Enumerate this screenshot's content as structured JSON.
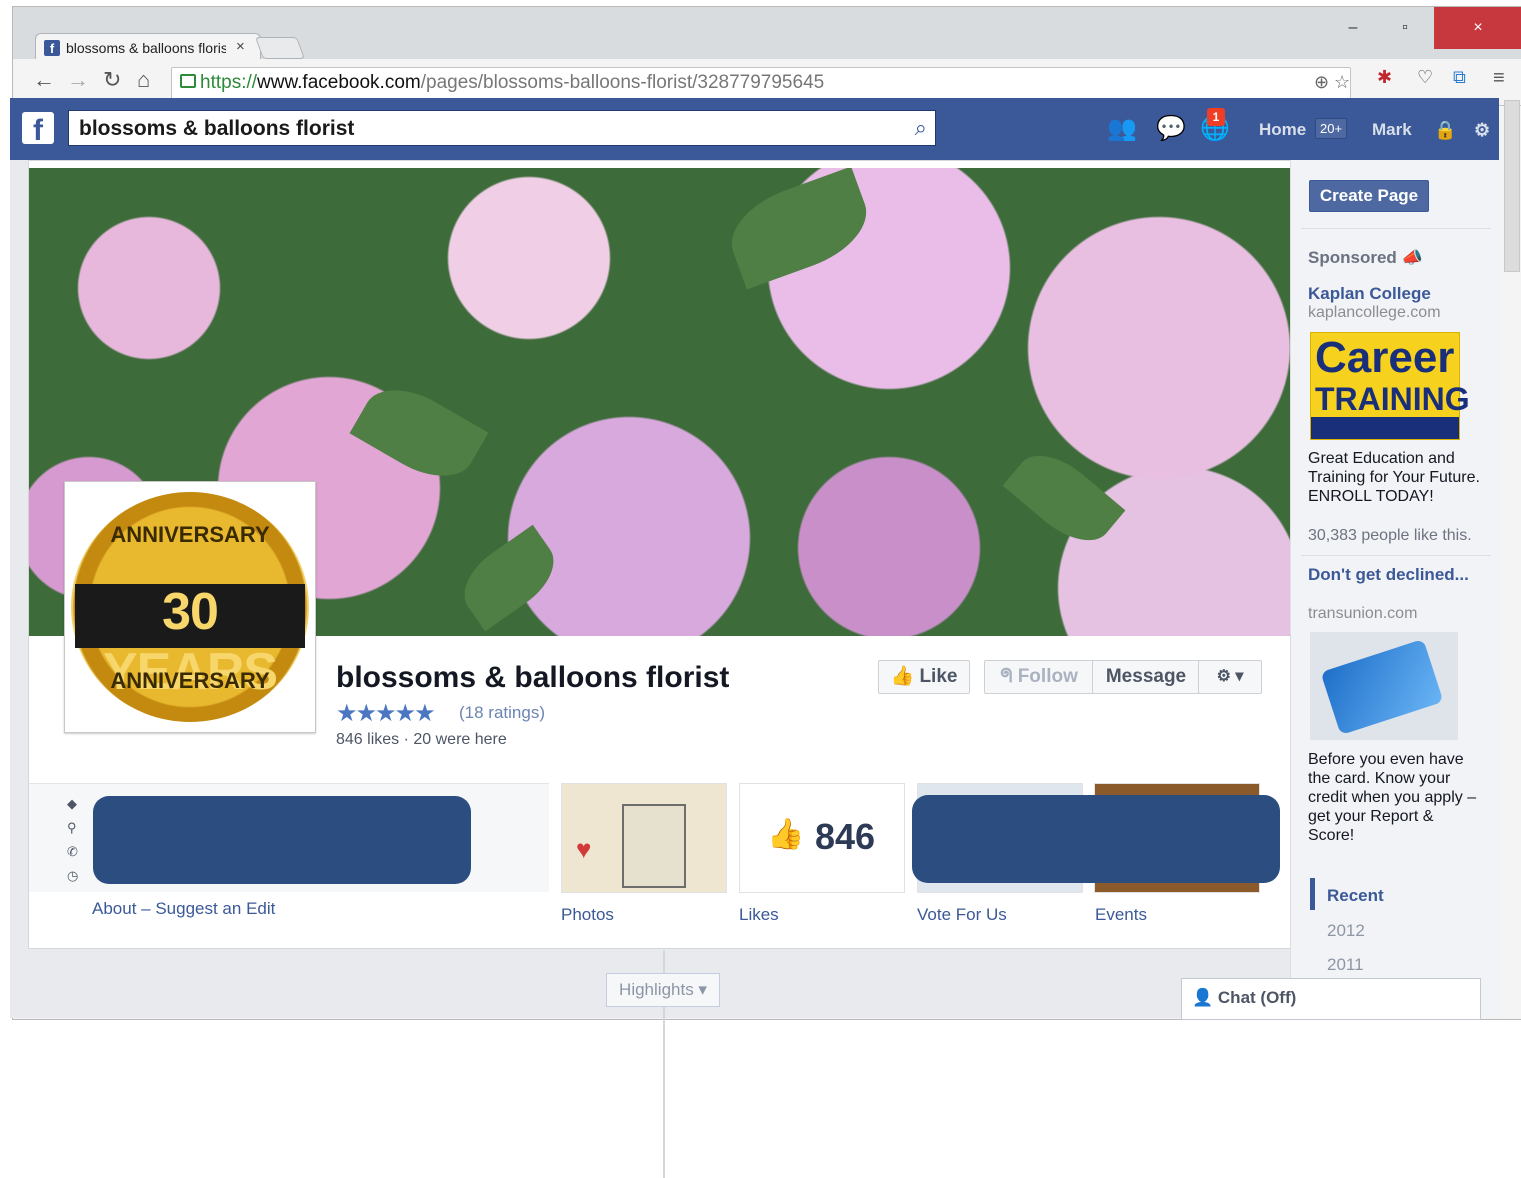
{
  "browser": {
    "tab_title": "blossoms & balloons floris",
    "tab_close": "×",
    "url_scheme": "https://",
    "url_host": "www.facebook.com",
    "url_path": "/pages/blossoms-balloons-florist/328779795645",
    "window_buttons": [
      "–",
      "▫",
      "×"
    ]
  },
  "fb": {
    "logo": "f",
    "search_value": "blossoms & balloons florist",
    "notification_count": "1",
    "nav_home": "Home",
    "home_count": "20+",
    "nav_user": "Mark"
  },
  "page": {
    "name": "blossoms & balloons florist",
    "stars": "★★★★★",
    "ratings": "(18 ratings)",
    "likes_line": "846 likes · 20 were here",
    "profile_seal": {
      "top": "ANNIVERSARY",
      "center": "30 YEARS",
      "bottom": "ANNIVERSARY"
    },
    "buttons": {
      "like": "Like",
      "follow": "Follow",
      "message": "Message",
      "gear": "⚙ ▾"
    },
    "tiles": {
      "likes_count": "846",
      "photos_label": "Photos",
      "likes_label": "Likes",
      "vote_label": "Vote For Us",
      "events_label": "Events"
    },
    "about_links": "About – Suggest an Edit",
    "highlights": "Highlights ▾"
  },
  "right_col": {
    "create_page": "Create Page",
    "sponsored": "Sponsored",
    "ad1": {
      "title": "Kaplan College",
      "domain": "kaplancollege.com",
      "image_big": "Career",
      "image_small": "TRAINING",
      "body": "Great Education and Training for Your Future. ENROLL TODAY!",
      "social": "30,383 people like this."
    },
    "ad2": {
      "title": "Don't get declined...",
      "domain": "transunion.com",
      "body": "Before you even have the card. Know your credit when you apply – get your Report & Score!"
    },
    "years": [
      "Recent",
      "2012",
      "2011"
    ]
  },
  "chat": {
    "label": "Chat (Off)"
  },
  "colors": {
    "fb_blue": "#3b5998",
    "link": "#3b5998",
    "notif_red": "#f03d25"
  }
}
